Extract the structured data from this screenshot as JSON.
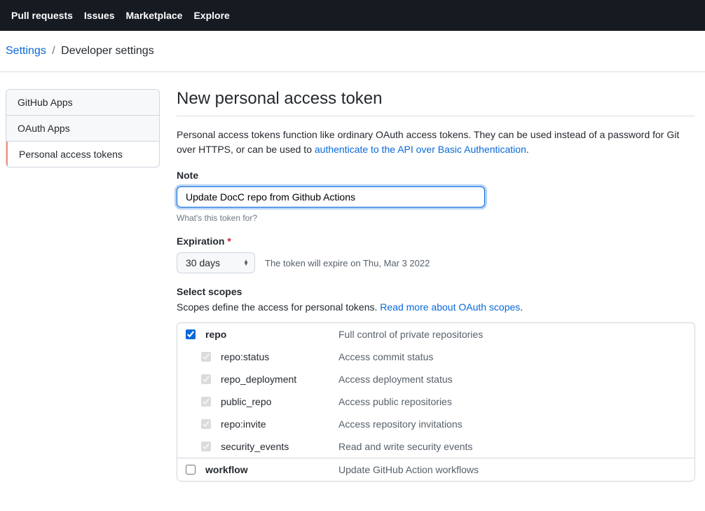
{
  "topnav": {
    "items": [
      {
        "label": "Pull requests"
      },
      {
        "label": "Issues"
      },
      {
        "label": "Marketplace"
      },
      {
        "label": "Explore"
      }
    ]
  },
  "breadcrumb": {
    "root": "Settings",
    "current": "Developer settings"
  },
  "sidebar": {
    "items": [
      {
        "label": "GitHub Apps"
      },
      {
        "label": "OAuth Apps"
      },
      {
        "label": "Personal access tokens"
      }
    ]
  },
  "page": {
    "title": "New personal access token",
    "intro_prefix": "Personal access tokens function like ordinary OAuth access tokens. They can be used instead of a password for Git over HTTPS, or can be used to ",
    "intro_link": "authenticate to the API over Basic Authentication",
    "intro_suffix": "."
  },
  "note": {
    "label": "Note",
    "value": "Update DocC repo from Github Actions",
    "hint": "What's this token for?"
  },
  "expiration": {
    "label": "Expiration",
    "value": "30 days",
    "note": "The token will expire on Thu, Mar 3 2022"
  },
  "scopes": {
    "label": "Select scopes",
    "intro_prefix": "Scopes define the access for personal tokens. ",
    "intro_link": "Read more about OAuth scopes",
    "intro_suffix": ".",
    "groups": [
      {
        "name": "repo",
        "desc": "Full control of private repositories",
        "checked": true,
        "children": [
          {
            "name": "repo:status",
            "desc": "Access commit status"
          },
          {
            "name": "repo_deployment",
            "desc": "Access deployment status"
          },
          {
            "name": "public_repo",
            "desc": "Access public repositories"
          },
          {
            "name": "repo:invite",
            "desc": "Access repository invitations"
          },
          {
            "name": "security_events",
            "desc": "Read and write security events"
          }
        ]
      },
      {
        "name": "workflow",
        "desc": "Update GitHub Action workflows",
        "checked": false,
        "children": []
      }
    ]
  }
}
